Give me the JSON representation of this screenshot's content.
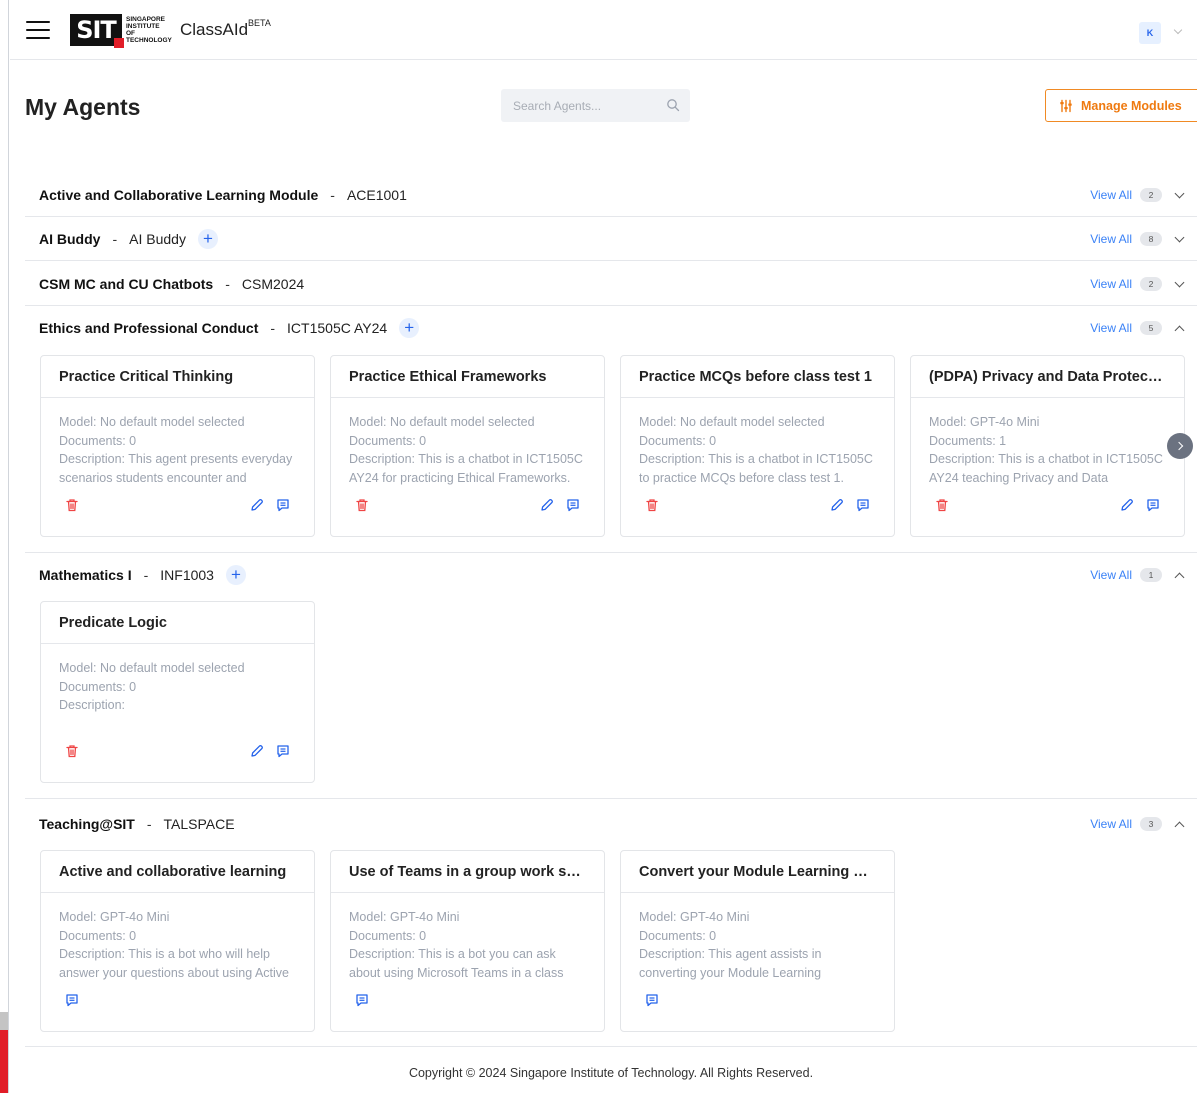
{
  "header": {
    "logo": {
      "mark": "SIT",
      "text": "Singapore Institute of Technology"
    },
    "app_name": "ClassAId",
    "app_tag": "BETA",
    "user_initial": "K"
  },
  "page": {
    "title": "My Agents",
    "search_placeholder": "Search Agents...",
    "manage_modules_label": "Manage Modules"
  },
  "modules": [
    {
      "name": "Active and Collaborative Learning Module",
      "code": "ACE1001",
      "view_all": "View All",
      "count": "2",
      "expanded": false,
      "can_add": false
    },
    {
      "name": "AI Buddy",
      "code": "AI Buddy",
      "view_all": "View All",
      "count": "8",
      "expanded": false,
      "can_add": true
    },
    {
      "name": "CSM MC and CU Chatbots",
      "code": "CSM2024",
      "view_all": "View All",
      "count": "2",
      "expanded": false,
      "can_add": false
    },
    {
      "name": "Ethics and Professional Conduct",
      "code": "ICT1505C AY24",
      "view_all": "View All",
      "count": "5",
      "expanded": true,
      "can_add": true,
      "agents": [
        {
          "title": "Practice Critical Thinking",
          "model": "Model: No default model selected",
          "documents": "Documents: 0",
          "description": "Description: This agent presents everyday scenarios students encounter and encourages them to think critically"
        },
        {
          "title": "Practice Ethical Frameworks",
          "model": "Model: No default model selected",
          "documents": "Documents: 0",
          "description": "Description: This is a chatbot in ICT1505C AY24 for practicing Ethical Frameworks."
        },
        {
          "title": "Practice MCQs before class test 1",
          "model": "Model: No default model selected",
          "documents": "Documents: 0",
          "description": "Description: This is a chatbot in ICT1505C to practice MCQs before class test 1."
        },
        {
          "title": "(PDPA) Privacy and Data Protection",
          "model": "Model: GPT-4o Mini",
          "documents": "Documents: 1",
          "description": "Description: This is a chatbot in ICT1505C AY24 teaching Privacy and Data Protection"
        }
      ]
    },
    {
      "name": "Mathematics I",
      "code": "INF1003",
      "view_all": "View All",
      "count": "1",
      "expanded": true,
      "can_add": true,
      "agents": [
        {
          "title": "Predicate Logic",
          "model": "Model: No default model selected",
          "documents": "Documents: 0",
          "description": "Description:"
        }
      ]
    },
    {
      "name": "Teaching@SIT",
      "code": "TALSPACE",
      "view_all": "View All",
      "count": "3",
      "expanded": true,
      "can_add": false,
      "agents": [
        {
          "title": "Active and collaborative learning",
          "model": "Model: GPT-4o Mini",
          "documents": "Documents: 0",
          "description": "Description: This is a bot who will help answer your questions about using Active and collaborative learning strategies in"
        },
        {
          "title": "Use of Teams in a group work sett...",
          "model": "Model: GPT-4o Mini",
          "documents": "Documents: 0",
          "description": "Description: This is a bot you can ask about using Microsoft Teams in a class group work setting"
        },
        {
          "title": "Convert your Module Learning O...",
          "model": "Model: GPT-4o Mini",
          "documents": "Documents: 0",
          "description": "Description: This agent assists in converting your Module Learning Outcomes into Competency Statements"
        }
      ]
    }
  ],
  "footer": {
    "copyright": "Copyright © 2024 Singapore Institute of Technology. All Rights Reserved."
  },
  "colors": {
    "accent_orange": "#ef7a10",
    "link_blue": "#3b82f6",
    "delete_red": "#ef4444",
    "brand_red": "#e11d28"
  }
}
